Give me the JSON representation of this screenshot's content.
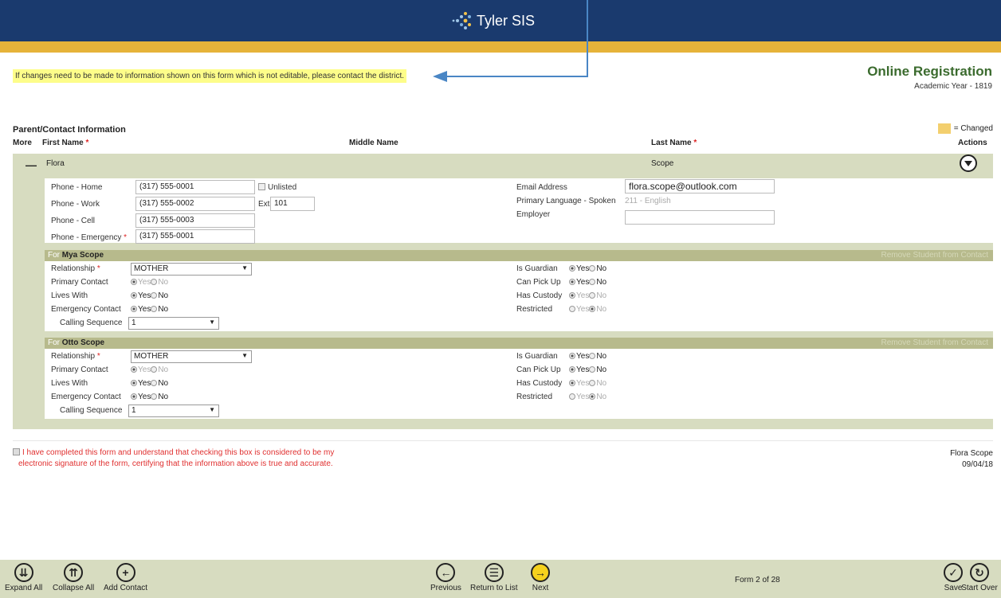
{
  "header": {
    "brand": "Tyler SIS"
  },
  "notice": "If changes need to be made to information shown on this form which is not editable, please contact the district.",
  "title": {
    "main": "Online Registration",
    "sub": "Academic Year - 1819"
  },
  "section": {
    "title": "Parent/Contact Information",
    "changed_legend": "= Changed",
    "columns": {
      "more": "More",
      "first": "First Name",
      "middle": "Middle Name",
      "last": "Last Name",
      "actions": "Actions",
      "req": "*"
    }
  },
  "contact": {
    "first": "Flora",
    "last": "Scope",
    "phones": {
      "home_label": "Phone - Home",
      "home": "(317) 555-0001",
      "unlisted": "Unlisted",
      "work_label": "Phone - Work",
      "work": "(317) 555-0002",
      "ext_label": "Ext.",
      "ext": "101",
      "cell_label": "Phone - Cell",
      "cell": "(317) 555-0003",
      "emergency_label": "Phone - Emergency",
      "emergency": "(317) 555-0001"
    },
    "email_label": "Email Address",
    "email": "flora.scope@outlook.com",
    "language_label": "Primary Language - Spoken",
    "language": "211 - English",
    "employer_label": "Employer",
    "employer": ""
  },
  "students": [
    {
      "for": "For",
      "name": "Mya Scope",
      "remove": "Remove Student from Contact",
      "relationship_label": "Relationship",
      "relationship": "MOTHER",
      "primary_label": "Primary Contact",
      "lives_label": "Lives With",
      "emergency_label": "Emergency Contact",
      "calling_label": "Calling Sequence",
      "calling": "1",
      "guardian_label": "Is Guardian",
      "pickup_label": "Can Pick Up",
      "custody_label": "Has Custody",
      "restricted_label": "Restricted"
    },
    {
      "for": "For",
      "name": "Otto Scope",
      "remove": "Remove Student from Contact",
      "relationship_label": "Relationship",
      "relationship": "MOTHER",
      "primary_label": "Primary Contact",
      "lives_label": "Lives With",
      "emergency_label": "Emergency Contact",
      "calling_label": "Calling Sequence",
      "calling": "1",
      "guardian_label": "Is Guardian",
      "pickup_label": "Can Pick Up",
      "custody_label": "Has Custody",
      "restricted_label": "Restricted"
    }
  ],
  "radio": {
    "yes": "Yes",
    "no": "No"
  },
  "signature": {
    "line1": "I have completed this form and understand that checking this box is considered to be my",
    "line2": "electronic signature of the form, certifying that the information above is true and accurate.",
    "name": "Flora Scope",
    "date": "09/04/18"
  },
  "footer": {
    "expand": "Expand All",
    "collapse": "Collapse All",
    "add": "Add Contact",
    "previous": "Previous",
    "return": "Return to List",
    "next": "Next",
    "form_count": "Form 2 of 28",
    "save": "Save",
    "start_over": "Start Over"
  },
  "colors": {
    "header": "#1a3a6e",
    "gold": "#e6b33a",
    "panel": "#d7dcc0",
    "title_green": "#3b6b2e"
  }
}
